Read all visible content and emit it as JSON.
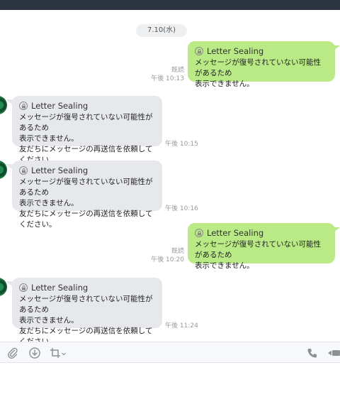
{
  "chat": {
    "date_label": "7.10(水)",
    "messages": [
      {
        "direction": "out",
        "title": "Letter Sealing",
        "body": "メッセージが復号されていない可能性があるため\n表示できません。",
        "read": "既読",
        "time": "午後 10:13"
      },
      {
        "direction": "in",
        "title": "Letter Sealing",
        "body": "メッセージが復号されていない可能性があるため\n表示できません。\n友だちにメッセージの再送信を依頼してください。",
        "time": "午後 10:15"
      },
      {
        "direction": "in",
        "title": "Letter Sealing",
        "body": "メッセージが復号されていない可能性があるため\n表示できません。\n友だちにメッセージの再送信を依頼してください。",
        "time": "午後 10:16"
      },
      {
        "direction": "out",
        "title": "Letter Sealing",
        "body": "メッセージが復号されていない可能性があるため\n表示できません。",
        "read": "既読",
        "time": "午後 10:20"
      },
      {
        "direction": "in",
        "title": "Letter Sealing",
        "body": "メッセージが復号されていない可能性があるため\n表示できません。\n友だちにメッセージの再送信を依頼してください。",
        "time": "午後 11:24"
      }
    ]
  },
  "toolbar": {
    "icons": [
      "paperclip-icon",
      "download-icon",
      "crop-icon",
      "chevron-down-icon",
      "phone-icon",
      "video-icon"
    ]
  },
  "colors": {
    "outgoing_bubble": "#b9ea86",
    "incoming_bubble": "#e6e8eb",
    "top_bar": "#2c3442"
  }
}
